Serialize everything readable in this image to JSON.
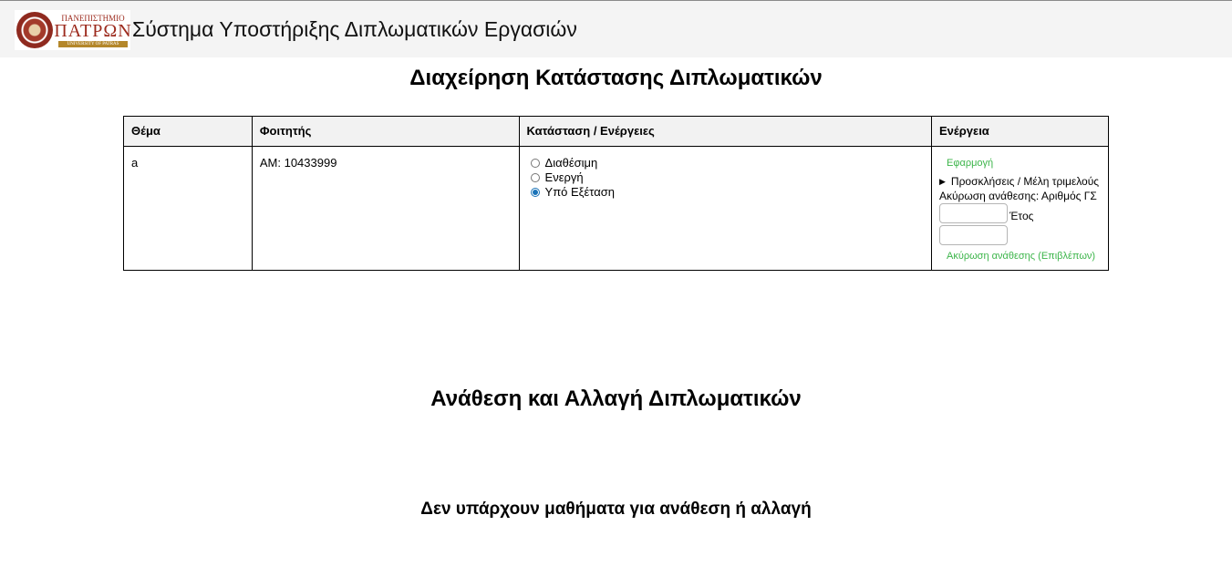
{
  "header": {
    "logo": {
      "line1": "ΠΑΝΕΠΙΣΤΗΜΙΟ",
      "line2": "ΠΑΤΡΩΝ",
      "line3": "UNIVERSITY OF PATRAS"
    },
    "title": "Σύστημα Υποστήριξης Διπλωματικών Εργασιών"
  },
  "status_section": {
    "heading": "Διαχείρηση Κατάστασης Διπλωματικών",
    "columns": [
      "Θέμα",
      "Φοιτητής",
      "Κατάσταση / Ενέργειες",
      "Ενέργεια"
    ],
    "rows": [
      {
        "topic": "a",
        "student": "ΑΜ: 10433999",
        "status_options": [
          "Διαθέσιμη",
          "Ενεργή",
          "Υπό Εξέταση"
        ],
        "selected_status": "Υπό Εξέταση",
        "actions": {
          "apply_link": "Εφαρμογή",
          "invitations_summary": "Προσκλήσεις / Μέλη τριμελούς",
          "cancel_label": "Ακύρωση ανάθεσης: Αριθμός ΓΣ",
          "gs_number_value": "",
          "year_label": "Έτος",
          "year_value": "",
          "cancel_link": "Ακύρωση ανάθεσης (Επιβλέπων)"
        }
      }
    ]
  },
  "assign_section": {
    "heading": "Ανάθεση και Αλλαγή Διπλωματικών",
    "empty_message": "Δεν υπάρχουν μαθήματα για ανάθεση ή αλλαγή"
  },
  "colors": {
    "link_green": "#3cb54a",
    "header_bg": "#f4f4f4",
    "radio_selected": "#1a73b8"
  },
  "icons": [
    "university-seal-icon",
    "disclosure-triangle-icon"
  ]
}
